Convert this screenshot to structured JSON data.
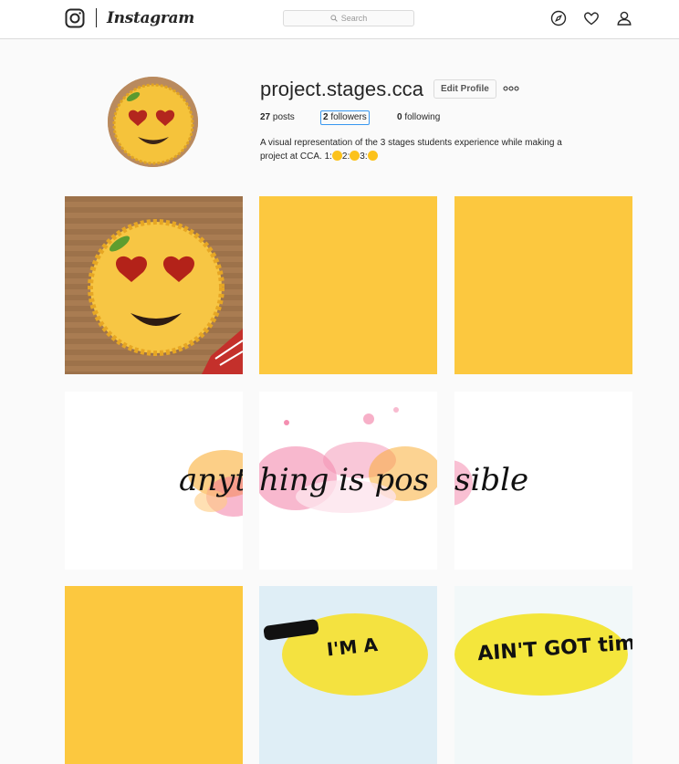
{
  "brand": {
    "wordmark": "Instagram"
  },
  "search": {
    "placeholder": "Search"
  },
  "profile": {
    "username": "project.stages.cca",
    "edit_label": "Edit Profile",
    "posts_count": "27",
    "posts_label": "posts",
    "followers_count": "2",
    "followers_label": "followers",
    "following_count": "0",
    "following_label": "following",
    "bio_line1": "A visual representation of the 3 stages students experience while making a",
    "bio_line2_a": "project at CCA. 1:",
    "bio_line2_b": "2:",
    "bio_line2_c": "3:"
  },
  "posts": {
    "banner_text_1": "anyt",
    "banner_text_2": "hing is pos",
    "banner_text_3": "sible",
    "caption_a": "I'M A",
    "caption_b": "AIN'T GOT time"
  },
  "colors": {
    "accent": "#3897f0",
    "post_yellow": "#fcc83f",
    "border": "#dbdbdb"
  },
  "icons": [
    "instagram-glyph-icon",
    "search-icon",
    "explore-compass-icon",
    "heart-icon",
    "profile-person-icon",
    "more-options-icon"
  ]
}
